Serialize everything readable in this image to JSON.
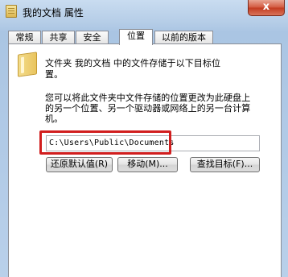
{
  "window": {
    "title": "我的文档 属性",
    "close_label": "x"
  },
  "tabs": [
    {
      "label": "常规"
    },
    {
      "label": "共享"
    },
    {
      "label": "安全"
    },
    {
      "label": "位置",
      "active": true
    },
    {
      "label": "以前的版本"
    }
  ],
  "location": {
    "description_line1": "文件夹 我的文档 中的文件存储于以下目标位",
    "description_line2": "置。",
    "info_line1": "您可以将此文件夹中文件存储的位置更改为此硬盘上",
    "info_line2": "的另一个位置、另一个驱动器或网络上的另一台计算",
    "info_line3": "机。",
    "path_value": "C:\\Users\\Public\\Documents"
  },
  "buttons": {
    "restore_default": "还原默认值(R)",
    "move": "移动(M)...",
    "find_target": "查找目标(F)..."
  }
}
